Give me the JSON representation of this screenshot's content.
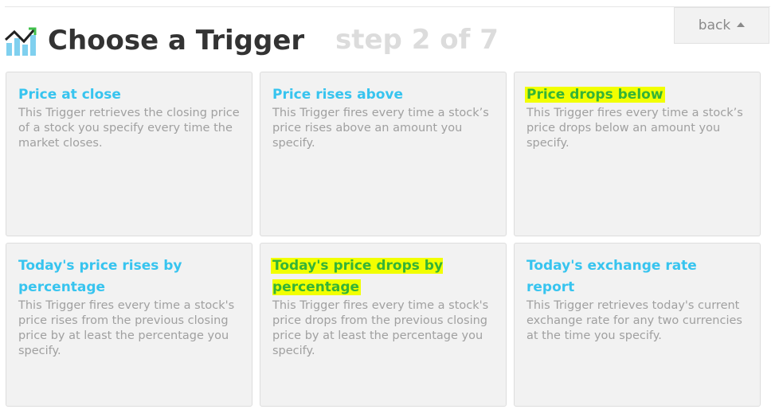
{
  "header": {
    "title": "Choose a Trigger",
    "step": "step 2 of 7",
    "icon": "stocks-chart-icon"
  },
  "toolbar": {
    "back_label": "back",
    "back_icon": "caret-up-icon"
  },
  "colors": {
    "card_title": "#37c4ef",
    "highlight": "#f2ff00",
    "highlight_text": "#35b437",
    "card_background": "#f2f2f2",
    "description": "#a0a0a0"
  },
  "triggers": [
    {
      "title": "Price at close",
      "description": "This Trigger retrieves the closing price of a stock you specify every time the market closes.",
      "highlighted": false
    },
    {
      "title": "Price rises above",
      "description": "This Trigger fires every time a stock’s price rises above an amount you specify.",
      "highlighted": false
    },
    {
      "title": "Price drops below",
      "description": "This Trigger fires every time a stock’s price drops below an amount you specify.",
      "highlighted": true
    },
    {
      "title": "Today's price rises by percentage",
      "description": "This Trigger fires every time a stock's price rises from the previous closing price by at least the percentage you specify.",
      "highlighted": false
    },
    {
      "title": "Today's price drops by percentage",
      "description": "This Trigger fires every time a stock's price drops from the previous closing price by at least the percentage you specify.",
      "highlighted": true
    },
    {
      "title": "Today's exchange rate report",
      "description": "This Trigger retrieves today's current exchange rate for any two currencies at the time you specify.",
      "highlighted": false
    }
  ]
}
